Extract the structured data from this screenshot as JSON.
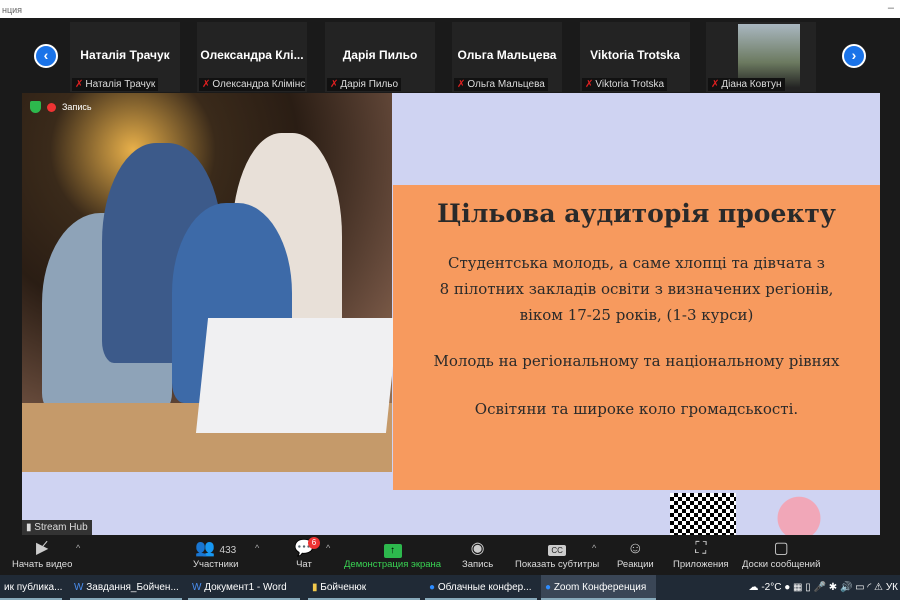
{
  "window": {
    "title": "нция",
    "minimize": "–"
  },
  "strip": {
    "prev": "‹",
    "next": "›",
    "participants": [
      {
        "display": "Наталія Трачук",
        "label": "Наталія Трачук"
      },
      {
        "display": "Олександра  Клі...",
        "label": "Олександра Клімінсь..."
      },
      {
        "display": "Дарія Пильо",
        "label": "Дарія Пильо"
      },
      {
        "display": "Ольга Мальцева",
        "label": "Ольга Мальцева"
      },
      {
        "display": "Viktoria Trotska",
        "label": "Viktoria Trotska"
      },
      {
        "display": "",
        "label": "Діана Ковтун"
      }
    ]
  },
  "main": {
    "recording": "Запись",
    "stream": "Stream Hub",
    "slide": {
      "title": "Цільова аудиторія проекту",
      "p1": [
        "Студентська молодь, а саме хлопці та дівчата з",
        "8 пілотних закладів освіти з визначених регіонів,",
        "віком 17-25 років, (1-3 курси)"
      ],
      "p2": "Молодь на регіональному та національному рівнях",
      "p3": "Освітяни та широке коло громадськості."
    }
  },
  "toolbar": {
    "video": "Начать видео",
    "participants": "Участники",
    "participants_count": "433",
    "chat": "Чат",
    "chat_badge": "6",
    "share": "Демонстрация экрана",
    "record": "Запись",
    "cc": "Показать субтитры",
    "cc_icon": "CC",
    "reactions": "Реакции",
    "apps": "Приложения",
    "whiteboards": "Доски сообщений",
    "caret": "^"
  },
  "taskbar": {
    "items": [
      "ик публика...",
      "Завдання_Бойчен...",
      "Документ1 - Word",
      "Бойченюк",
      "Облачные конфер...",
      "Zoom Конференция"
    ],
    "temp": "-2°C",
    "lang": "УК"
  }
}
